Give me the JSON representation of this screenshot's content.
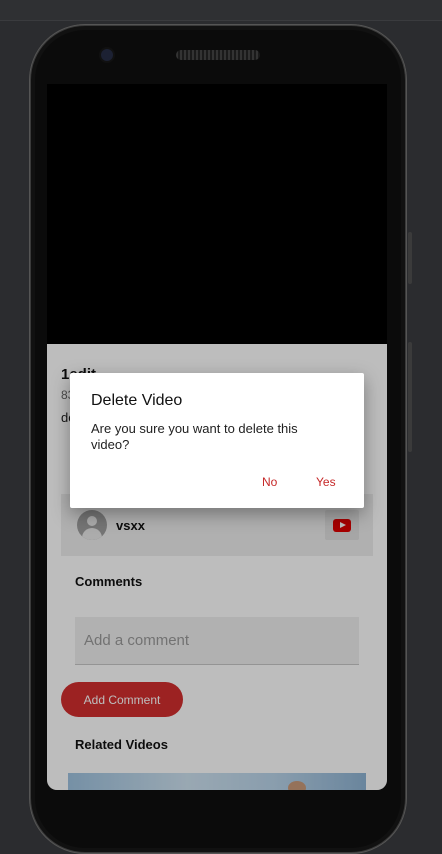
{
  "video": {
    "title": "1edit",
    "meta": "83",
    "description": "de"
  },
  "channel": {
    "name": "vsxx",
    "avatar_icon": "user-avatar-icon",
    "youtube_icon": "youtube-icon"
  },
  "comments": {
    "heading": "Comments",
    "input_placeholder": "Add a comment",
    "add_button_label": "Add Comment"
  },
  "related": {
    "heading": "Related Videos"
  },
  "dialog": {
    "title": "Delete Video",
    "message": "Are you sure you want to delete this video?",
    "no_label": "No",
    "yes_label": "Yes"
  },
  "colors": {
    "accent": "#d32f2f",
    "dialog_button": "#c62828",
    "youtube_red": "#e00000"
  }
}
